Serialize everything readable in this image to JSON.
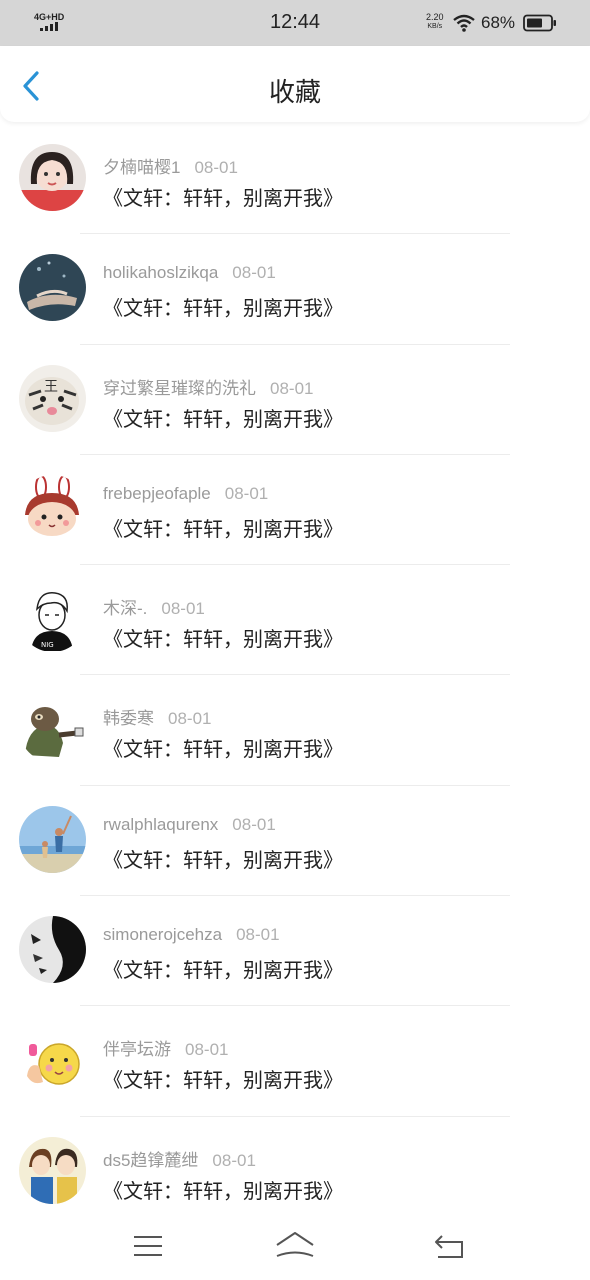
{
  "status_bar": {
    "network": "4G+HD",
    "time": "12:44",
    "speed_value": "2.20",
    "speed_unit": "KB/s",
    "battery": "68%"
  },
  "header": {
    "title": "收藏",
    "back_icon": "chevron-left-icon",
    "accent_color": "#2a93d6"
  },
  "items": [
    {
      "name": "夕楠喵樱1",
      "date": "08-01",
      "title": "《文轩：轩轩，别离开我》"
    },
    {
      "name": "holikahoslzikqa",
      "date": "08-01",
      "title": "《文轩：轩轩，别离开我》"
    },
    {
      "name": "穿过繁星璀璨的洗礼",
      "date": "08-01",
      "title": "《文轩：轩轩，别离开我》"
    },
    {
      "name": "frebepjeofaple",
      "date": "08-01",
      "title": "《文轩：轩轩，别离开我》"
    },
    {
      "name": "木深-.",
      "date": "08-01",
      "title": "《文轩：轩轩，别离开我》"
    },
    {
      "name": "韩委寒",
      "date": "08-01",
      "title": "《文轩：轩轩，别离开我》"
    },
    {
      "name": "rwalphlaqurenx",
      "date": "08-01",
      "title": "《文轩：轩轩，别离开我》"
    },
    {
      "name": "simonerojcehza",
      "date": "08-01",
      "title": "《文轩：轩轩，别离开我》"
    },
    {
      "name": "伴亭坛游",
      "date": "08-01",
      "title": "《文轩：轩轩，别离开我》"
    },
    {
      "name": "ds5趋镎麓绁",
      "date": "08-01",
      "title": "《文轩：轩轩，别离开我》"
    }
  ],
  "navbar": {
    "menu_icon": "menu-icon",
    "home_icon": "home-icon",
    "back_icon": "back-icon"
  }
}
